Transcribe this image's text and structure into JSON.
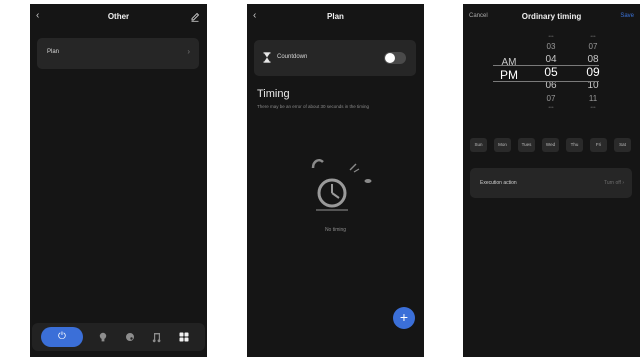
{
  "screen_other": {
    "back_icon": "chevron-left-icon",
    "title": "Other",
    "edit_icon": "pencil-icon",
    "plan_item": {
      "label": "Plan",
      "chevron": "›"
    },
    "tabbar": {
      "power_glyph": "⏻",
      "items": [
        "power-icon",
        "bulb-icon",
        "palette-icon",
        "music-icon",
        "grid-icon"
      ]
    }
  },
  "screen_plan": {
    "back_icon": "chevron-left-icon",
    "title": "Plan",
    "countdown": {
      "label": "Countdown",
      "enabled": false
    },
    "timing_title": "Timing",
    "timing_note": "There may be an error of about 30 seconds in the timing",
    "empty_text": "No timing",
    "add_glyph": "+"
  },
  "screen_timing": {
    "cancel": "Cancel",
    "title": "Ordinary timing",
    "save": "Save",
    "picker": {
      "period": {
        "above": "AM",
        "selected": "PM"
      },
      "hours": [
        "03",
        "04",
        "05",
        "06",
        "07"
      ],
      "minutes": [
        "07",
        "08",
        "09",
        "10",
        "11"
      ],
      "selected_hour": "05",
      "selected_minute": "09"
    },
    "days": [
      "Sun",
      "Mon",
      "Tues",
      "Wed",
      "Thu",
      "Fri",
      "Sat"
    ],
    "execution": {
      "label": "Execution action",
      "value": "Turn off ›"
    }
  },
  "colors": {
    "accent": "#3b6fd8",
    "background": "#151515",
    "card": "#262626"
  }
}
